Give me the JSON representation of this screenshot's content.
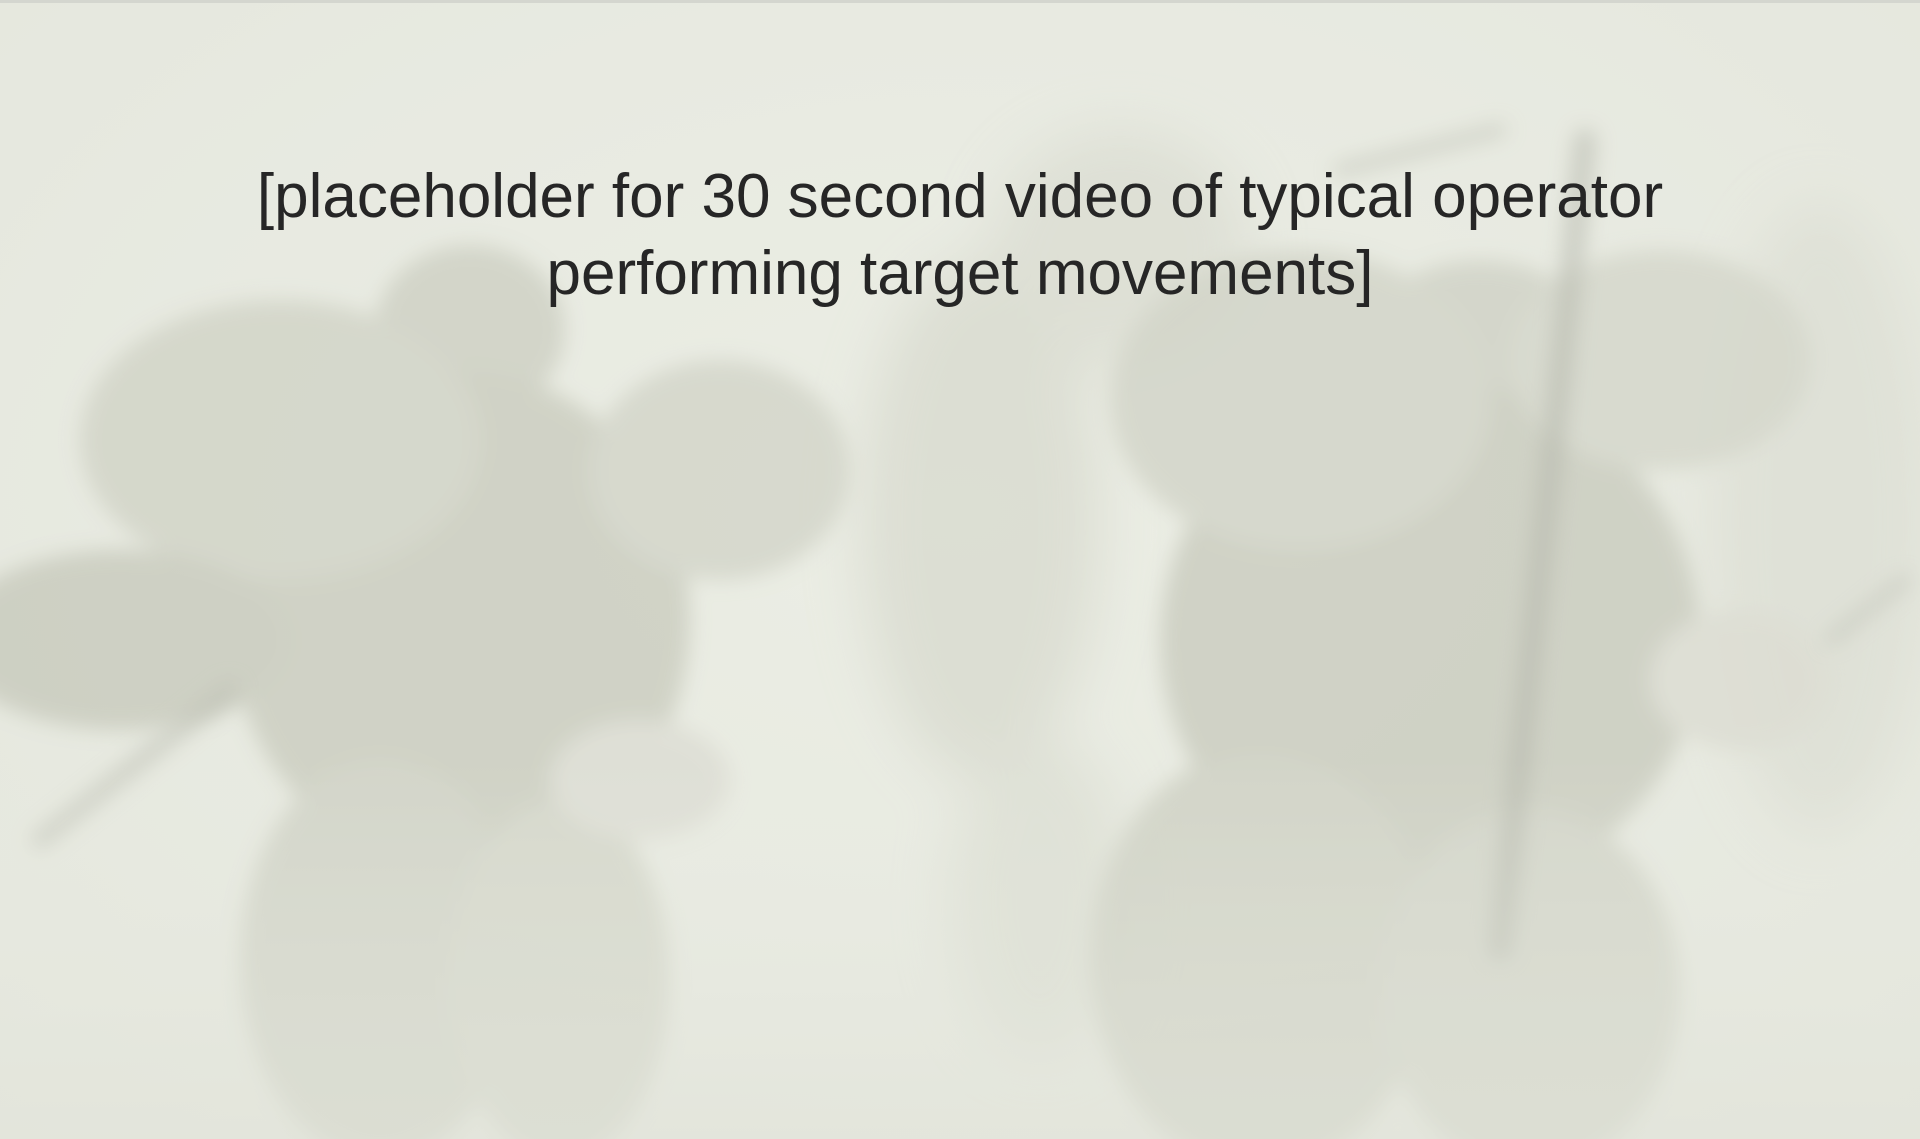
{
  "slide": {
    "background_image": "soldiers-carrying-comrades-photo",
    "caption": "[placeholder for 30 second video of typical operator performing target movements]"
  },
  "colors": {
    "caption_text": "#262626",
    "wash": "#eceee6"
  }
}
